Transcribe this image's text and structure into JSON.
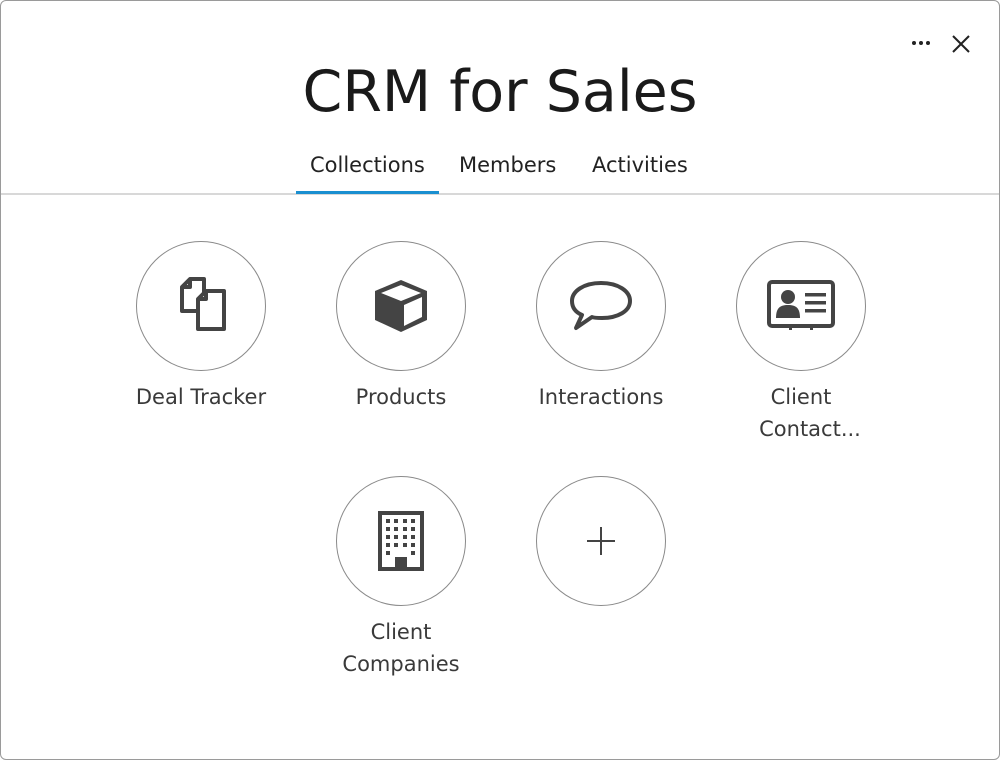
{
  "dialog": {
    "title": "CRM for Sales",
    "more_icon": "ellipsis-horizontal-icon",
    "close_icon": "close-x-icon"
  },
  "tabs": [
    {
      "label": "Collections",
      "active": true
    },
    {
      "label": "Members",
      "active": false
    },
    {
      "label": "Activities",
      "active": false
    }
  ],
  "collections": [
    {
      "label": "Deal Tracker",
      "icon": "documents-icon"
    },
    {
      "label": "Products",
      "icon": "cube-icon"
    },
    {
      "label": "Interactions",
      "icon": "speech-bubble-icon"
    },
    {
      "label_line1": "Client",
      "label_line2": "Contact...",
      "icon": "contact-card-icon"
    },
    {
      "label_line1": "Client",
      "label_line2": "Companies",
      "icon": "building-icon"
    },
    {
      "label": "",
      "icon": "plus-icon"
    }
  ],
  "colors": {
    "accent": "#1a8fd0",
    "icon": "#444444",
    "circle_border": "#8a8a8a"
  }
}
